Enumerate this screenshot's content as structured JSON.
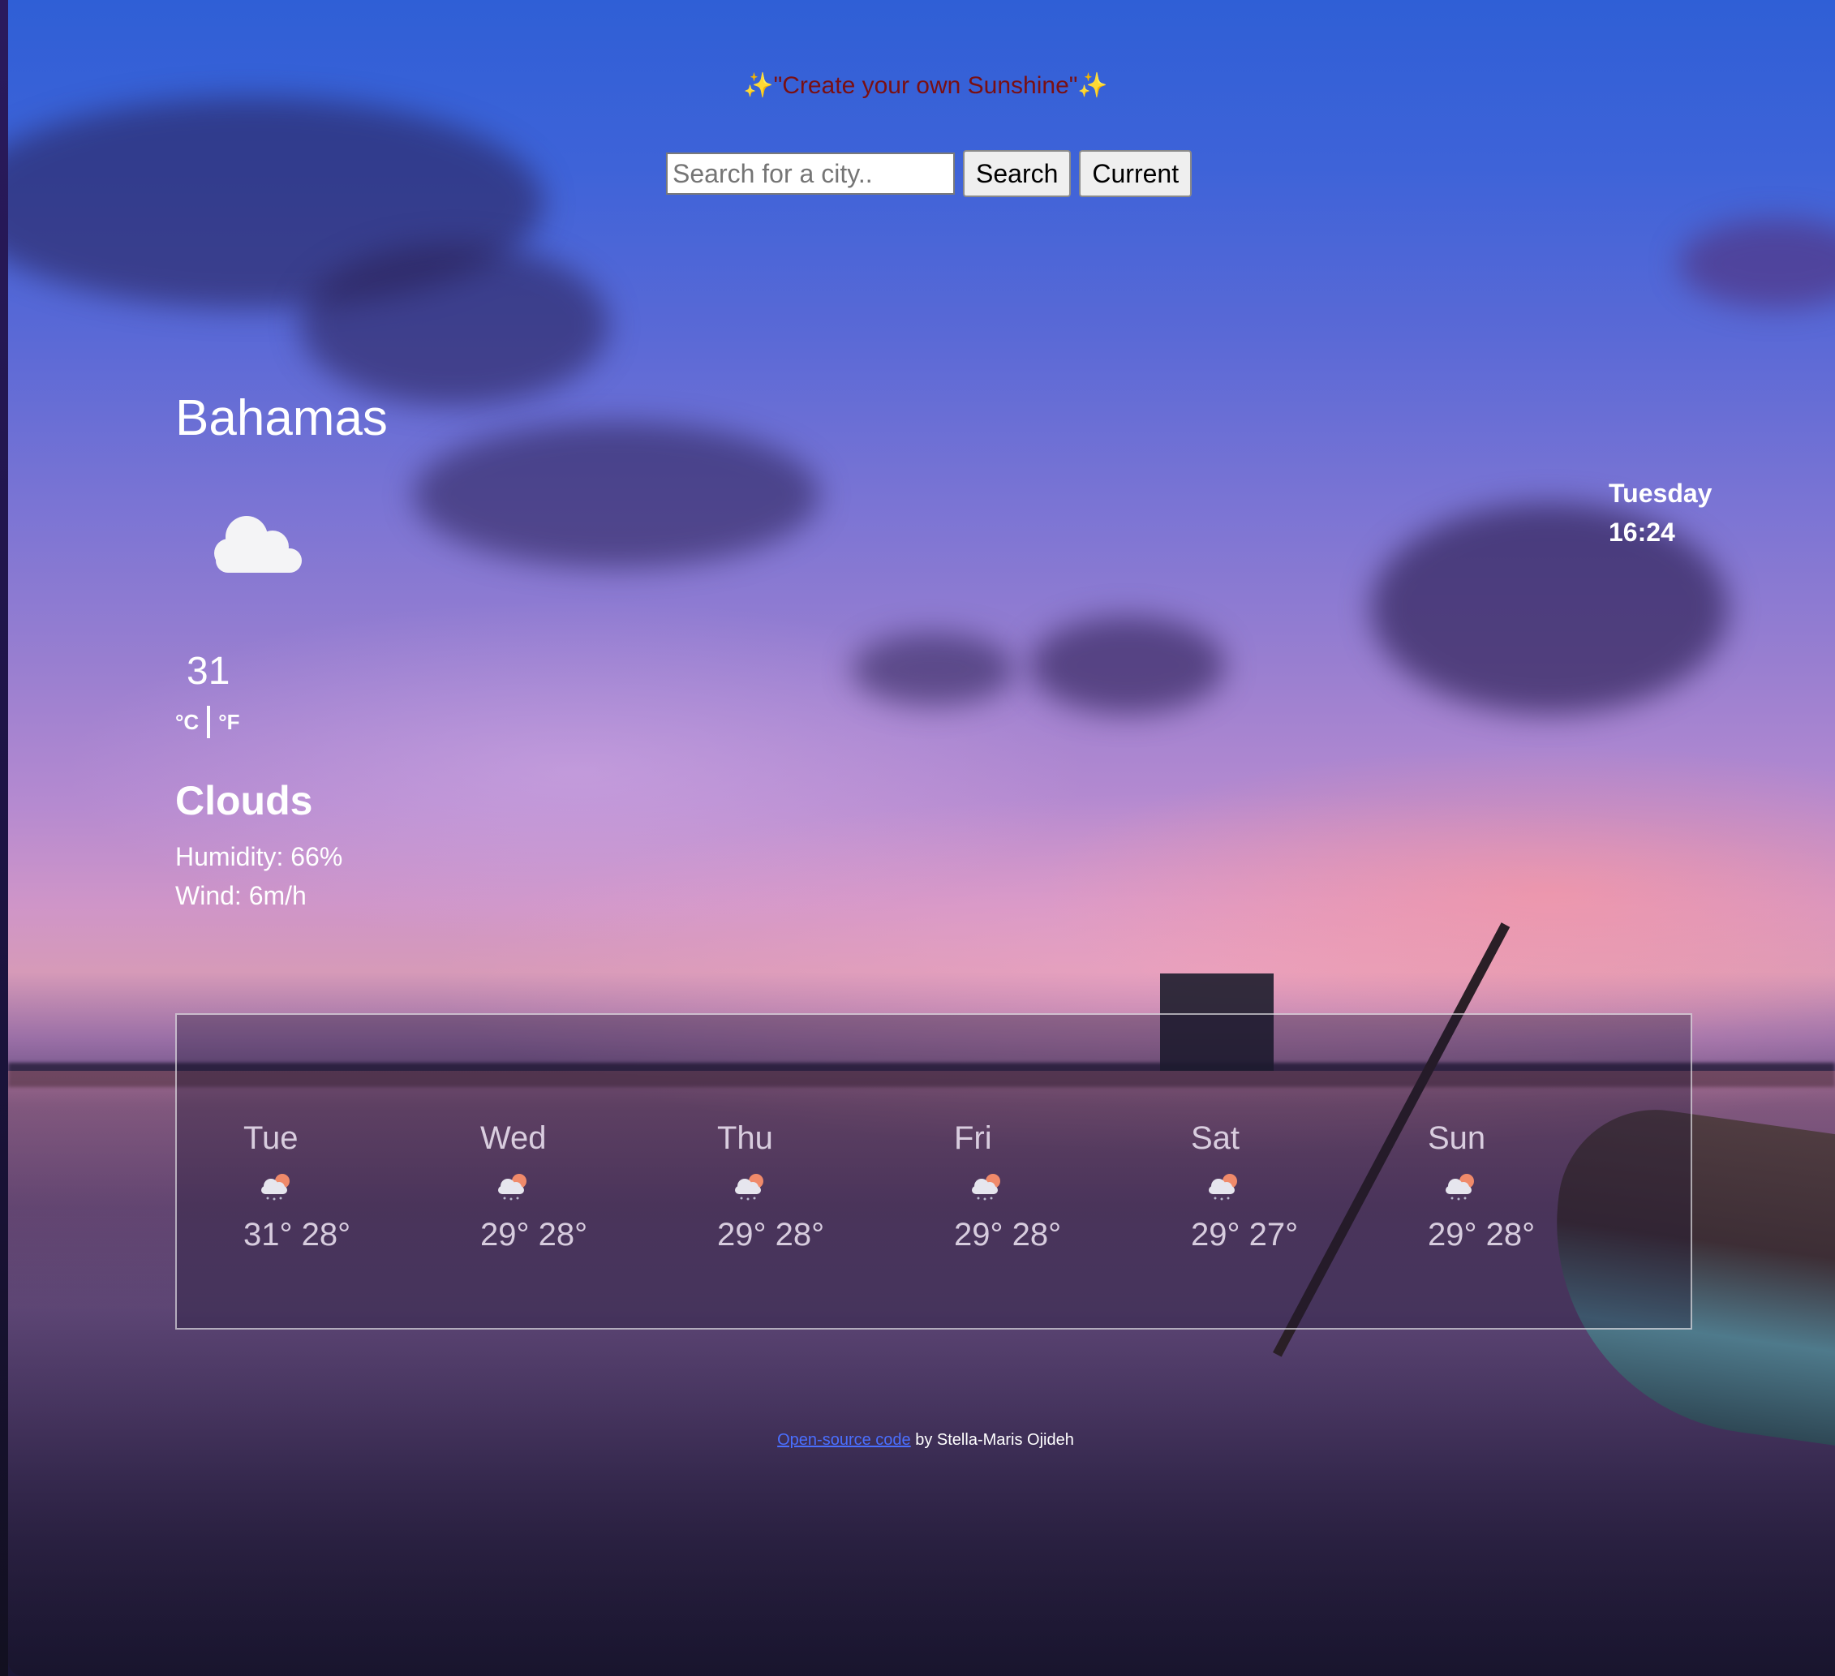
{
  "tagline": "✨\"Create your own Sunshine\"✨",
  "search": {
    "placeholder": "Search for a city..",
    "search_label": "Search",
    "current_label": "Current"
  },
  "current": {
    "city": "Bahamas",
    "icon": "cloud-icon",
    "temperature": "31",
    "unit_c": "°C",
    "unit_f": "°F",
    "condition": "Clouds",
    "humidity": "Humidity: 66%",
    "wind": "Wind: 6m/h"
  },
  "datetime": {
    "day": "Tuesday",
    "time": "16:24"
  },
  "forecast": [
    {
      "day": "Tue",
      "icon": "rain-cloud-sun-icon",
      "temps": "31° 28°"
    },
    {
      "day": "Wed",
      "icon": "rain-cloud-sun-icon",
      "temps": "29° 28°"
    },
    {
      "day": "Thu",
      "icon": "rain-cloud-sun-icon",
      "temps": "29° 28°"
    },
    {
      "day": "Fri",
      "icon": "rain-cloud-sun-icon",
      "temps": "29° 28°"
    },
    {
      "day": "Sat",
      "icon": "rain-cloud-sun-icon",
      "temps": "29° 27°"
    },
    {
      "day": "Sun",
      "icon": "rain-cloud-sun-icon",
      "temps": "29° 28°"
    }
  ],
  "footer": {
    "link_text": "Open-source code",
    "suffix": " by Stella-Maris Ojideh"
  }
}
